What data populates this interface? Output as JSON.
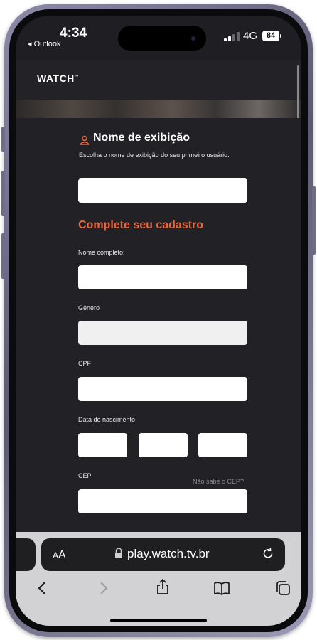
{
  "status_bar": {
    "time": "4:34",
    "back_app": "◂ Outlook",
    "network": "4G",
    "battery": "84"
  },
  "site": {
    "logo": "WATCH",
    "logo_mark": "™"
  },
  "display_name": {
    "title": "Nome de exibição",
    "subtitle": "Escolha o nome de exibição do seu primeiro usuário.",
    "value": ""
  },
  "registration": {
    "title": "Complete seu cadastro",
    "full_name_label": "Nome completo:",
    "gender_label": "Gênero",
    "cpf_label": "CPF",
    "birth_label": "Data de nascimento",
    "cep_label": "CEP",
    "cep_help": "Não sabe o CEP?"
  },
  "safari": {
    "text_size_label_small": "A",
    "text_size_label_large": "A",
    "url": "play.watch.tv.br"
  },
  "colors": {
    "accent": "#e8683c",
    "background": "#222126"
  },
  "icons": [
    "user-icon",
    "lock-icon",
    "reload-icon",
    "back-icon",
    "forward-icon",
    "share-icon",
    "bookmarks-icon",
    "tabs-icon"
  ]
}
